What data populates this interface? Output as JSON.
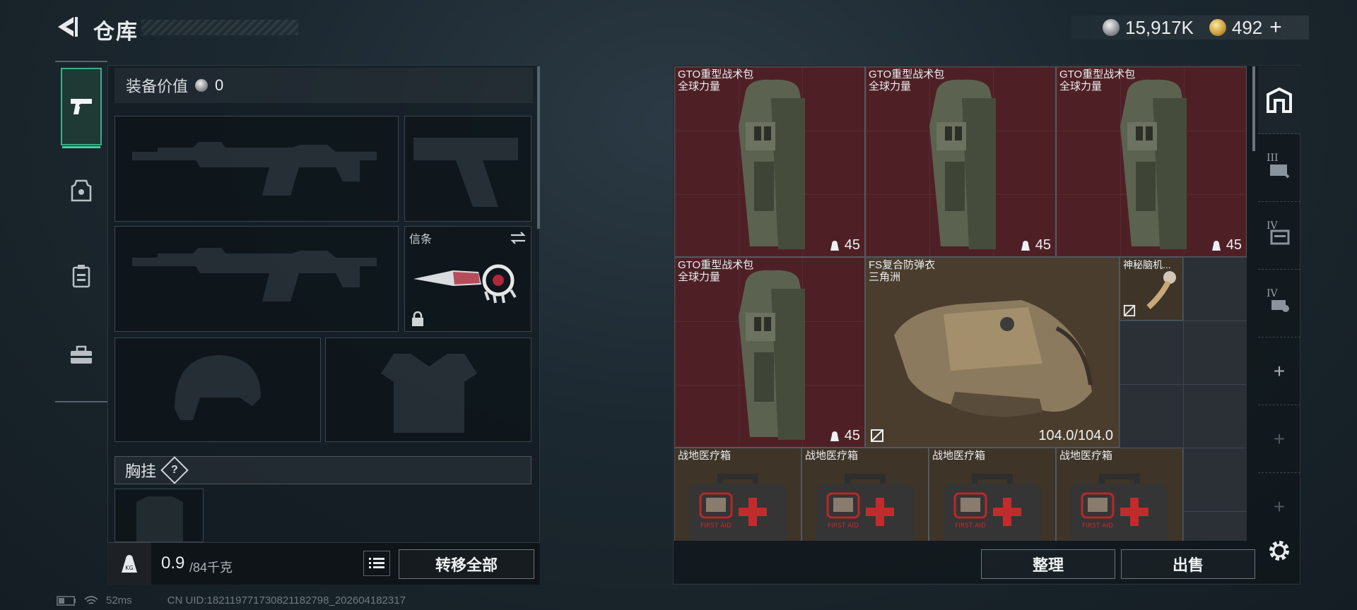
{
  "header": {
    "title": "仓库"
  },
  "currency": {
    "silver": "15,917K",
    "gold": "492",
    "gold_add": "+"
  },
  "equipment": {
    "value_label": "装备价值",
    "value": "0",
    "melee_slot_title": "信条",
    "chest_rig_label": "胸挂",
    "chest_rig_help": "?"
  },
  "weight": {
    "current": "0.9",
    "max": "/84千克",
    "icon_label": "KG"
  },
  "buttons": {
    "transfer_all": "转移全部",
    "sort": "整理",
    "sell": "出售"
  },
  "status": {
    "ping": "52ms",
    "uid": "CN UID:18211977173082118​2798_202604182317"
  },
  "inventory": {
    "backpacks": [
      {
        "name": "GTO重型战术包",
        "sub": "全球力量",
        "count": "45"
      },
      {
        "name": "GTO重型战术包",
        "sub": "全球力量",
        "count": "45"
      },
      {
        "name": "GTO重型战术包",
        "sub": "全球力量",
        "count": "45"
      },
      {
        "name": "GTO重型战术包",
        "sub": "全球力量",
        "count": "45"
      }
    ],
    "armor": {
      "name": "FS复合防弹衣",
      "sub": "三角洲",
      "durability": "104.0/104.0"
    },
    "mystery": {
      "name": "神秘脑机..."
    },
    "medkits": [
      {
        "name": "战地医疗箱",
        "label": "FIRST AID"
      },
      {
        "name": "战地医疗箱",
        "label": "FIRST AID"
      },
      {
        "name": "战地医疗箱",
        "label": "FIRST AID"
      },
      {
        "name": "战地医疗箱",
        "label": "FIRST AID"
      }
    ]
  },
  "right_tabs": {
    "roman_3": "III",
    "roman_4a": "IV",
    "roman_4b": "IV",
    "plus": "+"
  },
  "icons": [
    "back-arrow-icon",
    "silver-coin-icon",
    "gold-coin-icon",
    "pistol-icon",
    "armor-icon",
    "rig-icon",
    "toolbox-icon",
    "swap-icon",
    "lock-icon",
    "weight-icon",
    "list-icon",
    "bag-icon",
    "gear-icon",
    "help-icon"
  ]
}
